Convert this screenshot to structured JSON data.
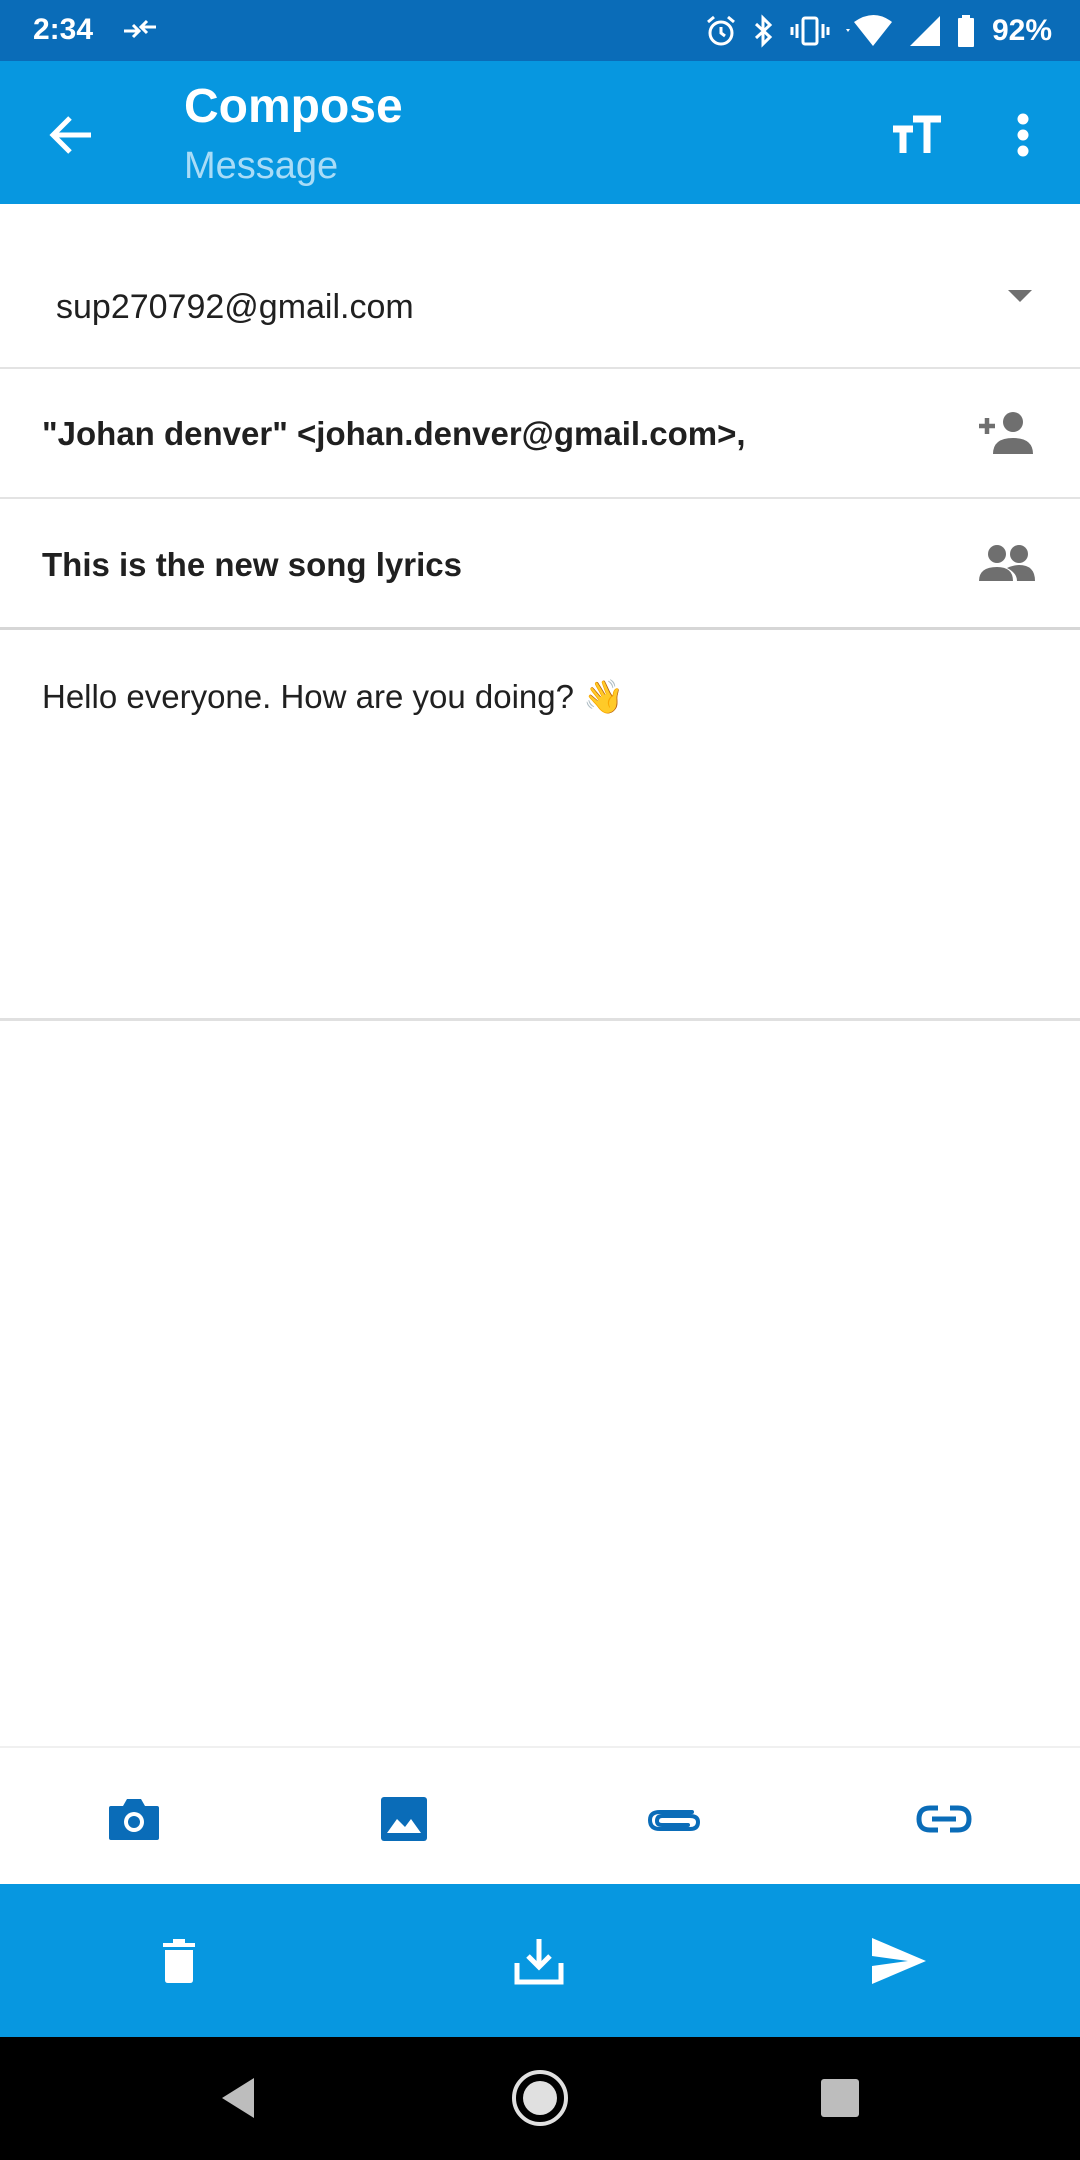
{
  "status_bar": {
    "time": "2:34",
    "battery": "92%"
  },
  "app_bar": {
    "title": "Compose",
    "subtitle": "Message"
  },
  "compose": {
    "from": "sup270792@gmail.com",
    "to": "\"Johan denver\" <johan.denver@gmail.com>,",
    "subject": "This is the new song lyrics",
    "body": "Hello everyone. How are you doing? 👋"
  },
  "colors": {
    "status_bar": "#0a6cb8",
    "app_bar": "#0797e0",
    "attachment_icon": "#0a6cb8",
    "icon_gray": "#6f6f6f"
  },
  "attachment_toolbar": [
    {
      "icon": "camera-icon"
    },
    {
      "icon": "image-icon"
    },
    {
      "icon": "paperclip-icon"
    },
    {
      "icon": "link-icon"
    }
  ],
  "action_bar": [
    {
      "icon": "trash-icon"
    },
    {
      "icon": "save-download-icon"
    },
    {
      "icon": "send-icon"
    }
  ],
  "nav_bar": [
    {
      "icon": "back-triangle-icon"
    },
    {
      "icon": "home-circle-icon"
    },
    {
      "icon": "recents-square-icon"
    }
  ]
}
